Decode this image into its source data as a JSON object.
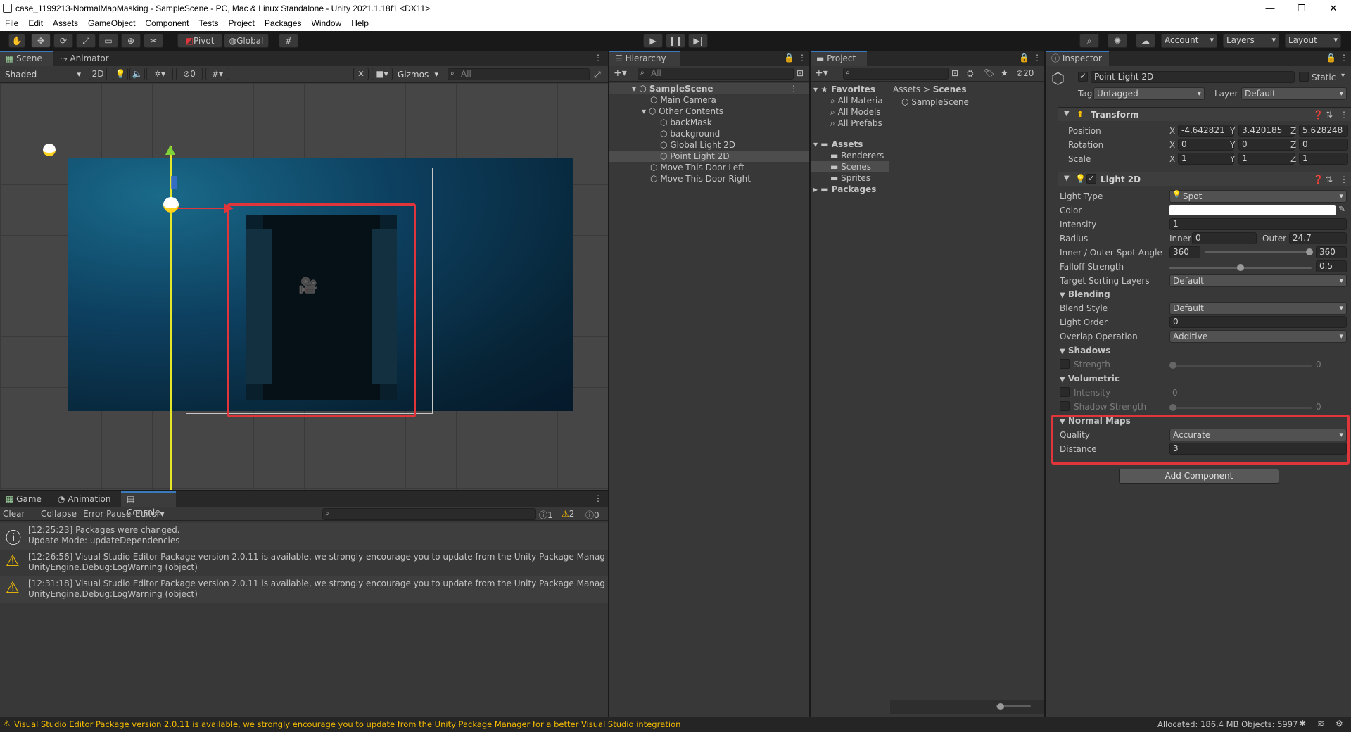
{
  "window": {
    "title": "case_1199213-NormalMapMasking - SampleScene - PC, Mac & Linux Standalone - Unity 2021.1.18f1 <DX11>"
  },
  "menu": [
    "File",
    "Edit",
    "Assets",
    "GameObject",
    "Component",
    "Tests",
    "Project",
    "Packages",
    "Window",
    "Help"
  ],
  "toolbar": {
    "pivot": "Pivot",
    "global": "Global",
    "account": "Account",
    "layers": "Layers",
    "layout": "Layout"
  },
  "scene": {
    "tab_scene": "Scene",
    "tab_animator": "Animator",
    "shading": "Shaded",
    "mode_2d": "2D",
    "hidden_count": "0",
    "gizmos": "Gizmos",
    "search_placeholder": "All"
  },
  "hierarchy": {
    "tab": "Hierarchy",
    "search_placeholder": "All",
    "items": [
      {
        "label": "SampleScene"
      },
      {
        "label": "Main Camera"
      },
      {
        "label": "Other Contents"
      },
      {
        "label": "backMask"
      },
      {
        "label": "background"
      },
      {
        "label": "Global Light 2D"
      },
      {
        "label": "Point Light 2D"
      },
      {
        "label": "Move This Door Left"
      },
      {
        "label": "Move This Door Right"
      }
    ]
  },
  "project": {
    "tab": "Project",
    "hidden_count": "20",
    "favorites": "Favorites",
    "fav_items": [
      "All Materia",
      "All Models",
      "All Prefabs"
    ],
    "assets": "Assets",
    "asset_items": [
      "Renderers",
      "Scenes",
      "Sprites"
    ],
    "packages": "Packages",
    "breadcrumb_root": "Assets",
    "breadcrumb_current": "Scenes",
    "content_item": "SampleScene"
  },
  "inspector": {
    "tab": "Inspector",
    "object_name": "Point Light 2D",
    "static_label": "Static",
    "tag_label": "Tag",
    "tag_value": "Untagged",
    "layer_label": "Layer",
    "layer_value": "Default",
    "transform": {
      "title": "Transform",
      "position_label": "Position",
      "rotation_label": "Rotation",
      "scale_label": "Scale",
      "position": {
        "x": "-4.642821",
        "y": "3.420185",
        "z": "5.628248"
      },
      "rotation": {
        "x": "0",
        "y": "0",
        "z": "0"
      },
      "scale": {
        "x": "1",
        "y": "1",
        "z": "1"
      },
      "x": "X",
      "y": "Y",
      "z": "Z"
    },
    "light2d": {
      "title": "Light 2D",
      "light_type_label": "Light Type",
      "light_type": "Spot",
      "color_label": "Color",
      "intensity_label": "Intensity",
      "intensity": "1",
      "radius_label": "Radius",
      "inner_label": "Inner",
      "inner": "0",
      "outer_label": "Outer",
      "outer": "24.7",
      "spot_angle_label": "Inner / Outer Spot Angle",
      "spot_inner": "360",
      "spot_outer": "360",
      "falloff_label": "Falloff Strength",
      "falloff": "0.5",
      "sorting_label": "Target Sorting Layers",
      "sorting": "Default",
      "blending_title": "Blending",
      "blend_style_label": "Blend Style",
      "blend_style": "Default",
      "light_order_label": "Light Order",
      "light_order": "0",
      "overlap_label": "Overlap Operation",
      "overlap": "Additive",
      "shadows_title": "Shadows",
      "shadow_strength_label": "Strength",
      "shadow_strength": "0",
      "volumetric_title": "Volumetric",
      "vol_intensity_label": "Intensity",
      "vol_intensity": "0",
      "vol_shadow_label": "Shadow Strength",
      "vol_shadow": "0",
      "normal_maps_title": "Normal Maps",
      "quality_label": "Quality",
      "quality": "Accurate",
      "distance_label": "Distance",
      "distance": "3"
    },
    "add_component": "Add Component"
  },
  "bottom": {
    "tab_game": "Game",
    "tab_animation": "Animation",
    "tab_console": "Console",
    "clear": "Clear",
    "collapse": "Collapse",
    "error_pause": "Error Pause",
    "editor": "Editor",
    "count_info": "1",
    "count_warn": "2",
    "count_error": "0",
    "logs": [
      {
        "line1": "[12:25:23] Packages were changed.",
        "line2": "Update Mode: updateDependencies",
        "kind": "info"
      },
      {
        "line1": "[12:26:56] Visual Studio Editor Package version 2.0.11 is available, we strongly encourage you to update from the Unity Package Manager for a bette",
        "line2": "UnityEngine.Debug:LogWarning (object)",
        "kind": "warn"
      },
      {
        "line1": "[12:31:18] Visual Studio Editor Package version 2.0.11 is available, we strongly encourage you to update from the Unity Package Manager for a bette",
        "line2": "UnityEngine.Debug:LogWarning (object)",
        "kind": "warn"
      }
    ]
  },
  "status": {
    "message": "Visual Studio Editor Package version 2.0.11 is available, we strongly encourage you to update from the Unity Package Manager for a better Visual Studio integration",
    "memory": "Allocated: 186.4 MB Objects: 5997"
  },
  "colors": {
    "accent": "#3a79bb",
    "highlight_box": "#e0353a",
    "warning": "#f4bc02"
  }
}
